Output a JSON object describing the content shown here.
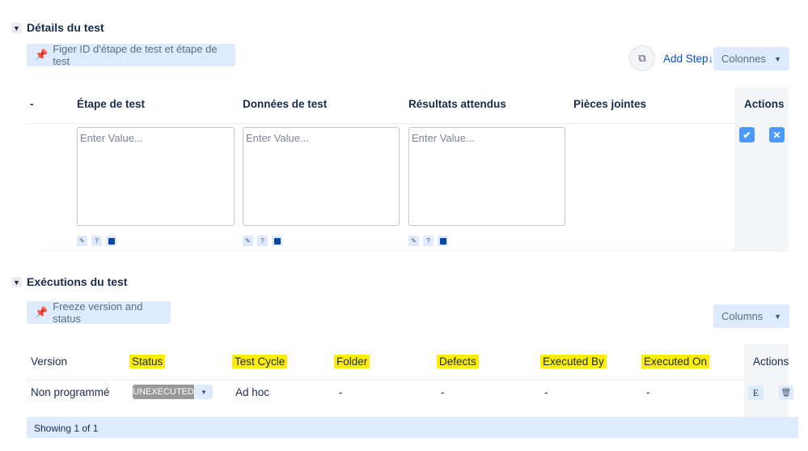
{
  "details": {
    "title": "Détails du test",
    "freeze_label": "Figer ID d'étape de test et étape de test",
    "add_step": "Add Step↓",
    "columns_label": "Colonnes",
    "headers": {
      "dash": "-",
      "step": "Étape de test",
      "data": "Données de test",
      "expected": "Résultats attendus",
      "attachments": "Pièces jointes",
      "actions": "Actions"
    },
    "placeholder": "Enter Value...",
    "help": "?"
  },
  "executions": {
    "title": "Exécutions du test",
    "freeze_label": "Freeze version and status",
    "columns_label": "Columns",
    "headers": {
      "version": "Version",
      "status": "Status",
      "cycle": "Test Cycle",
      "folder": "Folder",
      "defects": "Defects",
      "executed_by": "Executed By",
      "executed_on": "Executed On",
      "actions": "Actions"
    },
    "row": {
      "version": "Non programmé",
      "status": "UNEXECUTED",
      "cycle": "Ad hoc",
      "folder": "-",
      "defects": "-",
      "executed_by": "-",
      "executed_on": "-",
      "edit": "E"
    },
    "footer": "Showing 1 of 1"
  },
  "colors": {
    "highlight": "#ffee00",
    "accent": "#0052cc",
    "status_gray": "#999999"
  }
}
